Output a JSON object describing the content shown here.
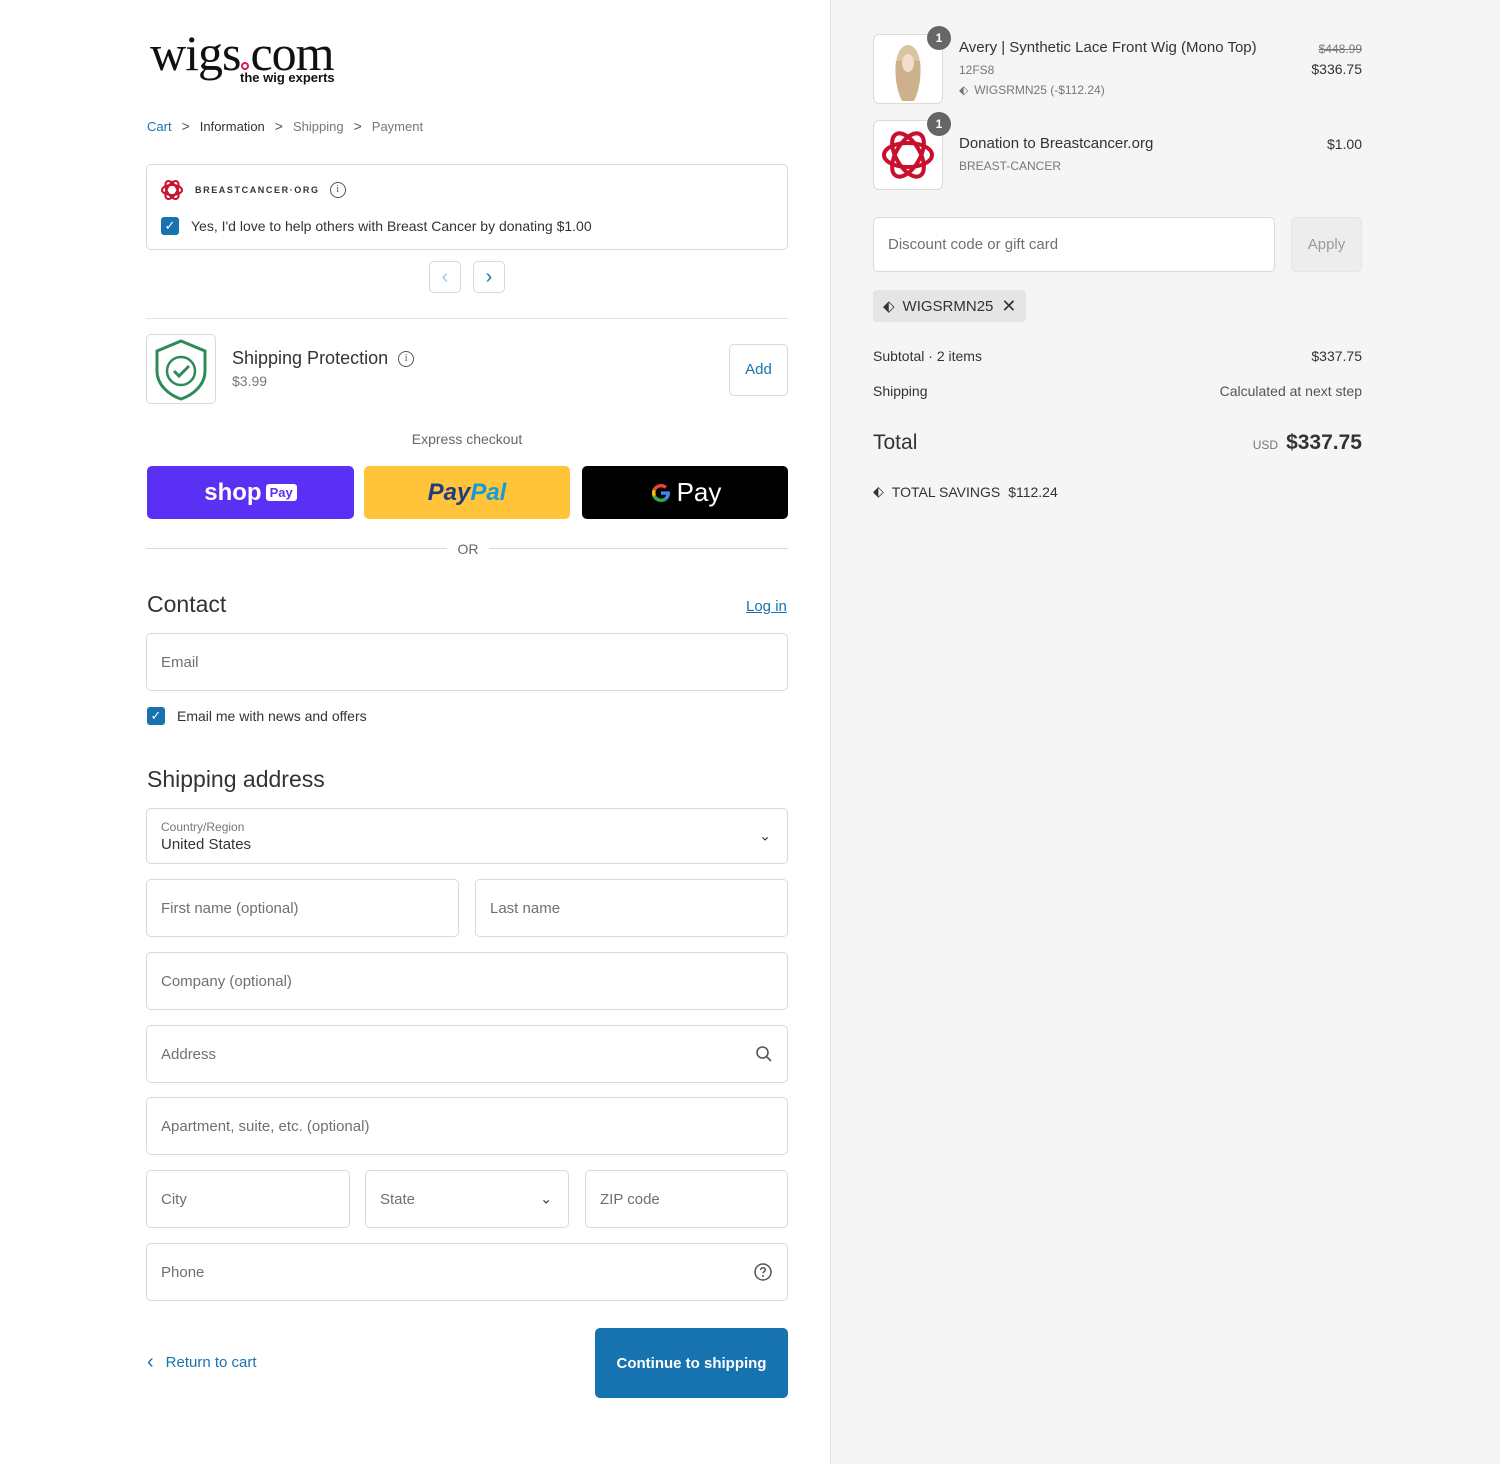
{
  "logo": {
    "text_main": "wigs",
    "text_com": "com",
    "tagline": "the wig experts"
  },
  "breadcrumb": {
    "cart": "Cart",
    "information": "Information",
    "shipping": "Shipping",
    "payment": "Payment",
    "sep": ">"
  },
  "donation": {
    "brand": "BREASTCANCER·ORG",
    "checkbox_label": "Yes, I'd love to help others with Breast Cancer by donating $1.00",
    "checked": true
  },
  "shipping_protection": {
    "title": "Shipping Protection",
    "price": "$3.99",
    "add_label": "Add"
  },
  "express": {
    "label": "Express checkout",
    "shoppay": "shop",
    "shoppay_tag": "Pay",
    "paypal_a": "Pay",
    "paypal_b": "Pal",
    "gpay": "Pay",
    "or": "OR"
  },
  "contact": {
    "heading": "Contact",
    "login": "Log in",
    "email_placeholder": "Email",
    "news_label": "Email me with news and offers",
    "news_checked": true
  },
  "shipping_address": {
    "heading": "Shipping address",
    "country_label": "Country/Region",
    "country_value": "United States",
    "first_name": "First name (optional)",
    "last_name": "Last name",
    "company": "Company (optional)",
    "address": "Address",
    "apartment": "Apartment, suite, etc. (optional)",
    "city": "City",
    "state": "State",
    "zip": "ZIP code",
    "phone": "Phone"
  },
  "footer": {
    "return": "Return to cart",
    "continue": "Continue to shipping"
  },
  "summary": {
    "items": [
      {
        "quantity": "1",
        "title": "Avery | Synthetic Lace Front Wig (Mono Top)",
        "variant": "12FS8",
        "discount": "WIGSRMN25 (-$112.24)",
        "original_price": "$448.99",
        "price": "$336.75"
      },
      {
        "quantity": "1",
        "title": "Donation to Breastcancer.org",
        "variant": "BREAST-CANCER",
        "price": "$1.00"
      }
    ],
    "discount_placeholder": "Discount code or gift card",
    "apply_label": "Apply",
    "applied_code": "WIGSRMN25",
    "subtotal_label": "Subtotal · 2 items",
    "subtotal_value": "$337.75",
    "shipping_label": "Shipping",
    "shipping_value": "Calculated at next step",
    "total_label": "Total",
    "currency": "USD",
    "total_value": "$337.75",
    "savings_label": "TOTAL SAVINGS",
    "savings_value": "$112.24"
  },
  "colors": {
    "accent": "#1773b0",
    "shoppay": "#5a31f4",
    "paypal": "#ffc439",
    "brand_pink": "#e2185b",
    "shield_green": "#2e8b57",
    "donation_red": "#c8102e"
  }
}
